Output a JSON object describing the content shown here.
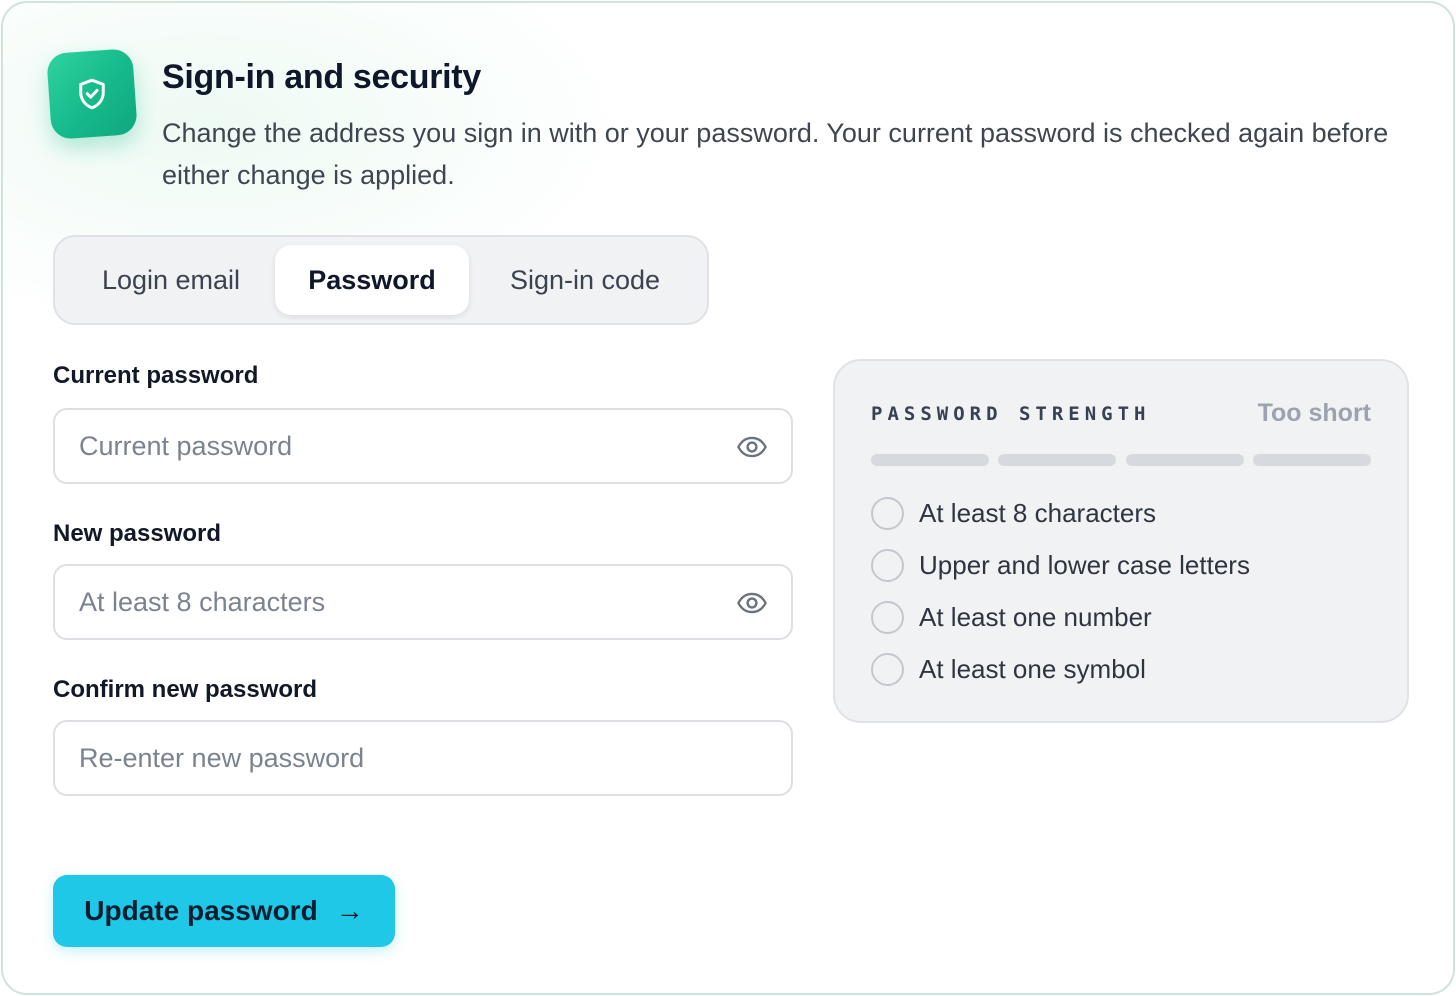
{
  "header": {
    "icon": "shield-check-icon",
    "title": "Sign-in and security",
    "subtitle": "Change the address you sign in with or your password. Your current password is checked again before either change is applied."
  },
  "tabs": [
    {
      "label": "Login email",
      "active": false
    },
    {
      "label": "Password",
      "active": true
    },
    {
      "label": "Sign-in code",
      "active": false
    }
  ],
  "form": {
    "current_password": {
      "label": "Current password",
      "placeholder": "Current password",
      "value": "",
      "icon": "eye-icon"
    },
    "new_password": {
      "label": "New password",
      "placeholder": "At least 8 characters",
      "value": "",
      "icon": "eye-icon"
    },
    "confirm_password": {
      "label": "Confirm new password",
      "placeholder": "Re-enter new password",
      "value": ""
    }
  },
  "strength": {
    "title": "PASSWORD STRENGTH",
    "status": "Too short",
    "level": 0,
    "segments": 4,
    "rules": [
      {
        "text": "At least 8 characters",
        "met": false
      },
      {
        "text": "Upper and lower case letters",
        "met": false
      },
      {
        "text": "At least one number",
        "met": false
      },
      {
        "text": "At least one symbol",
        "met": false
      }
    ]
  },
  "submit": {
    "label": "Update password",
    "arrow": "→"
  },
  "colors": {
    "accent": "#1ec8e6",
    "brand_green": "#16b98a",
    "muted_bar": "#d6d9de",
    "status_gray": "#9ca3af"
  }
}
